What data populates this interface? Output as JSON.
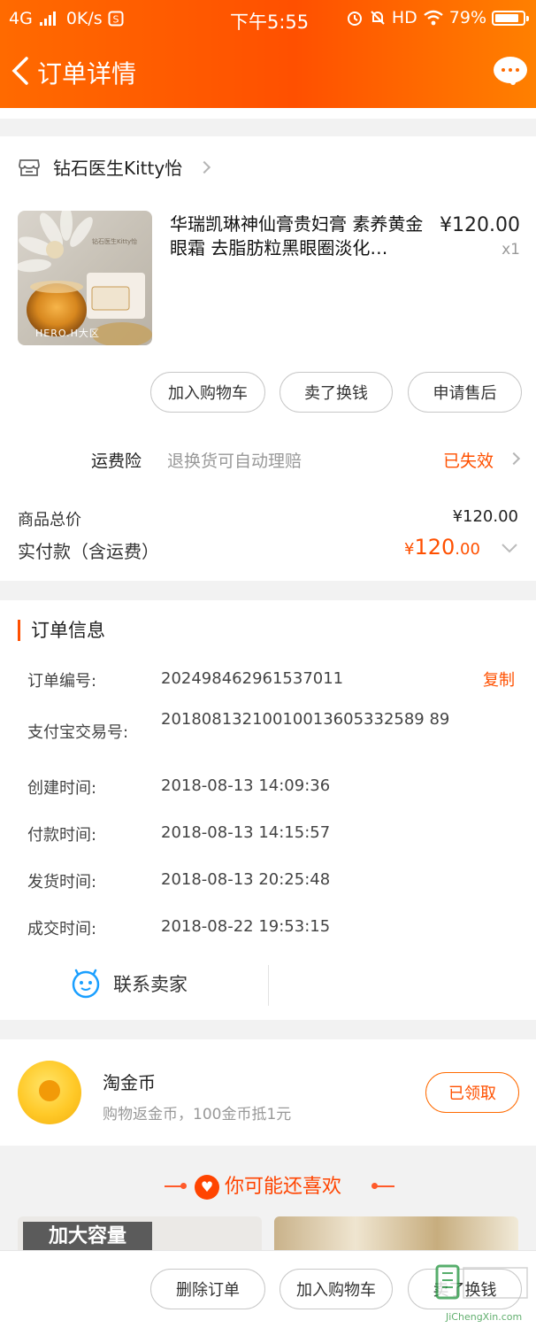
{
  "status_bar": {
    "network": "4G",
    "speed": "0K/s",
    "time": "下午5:55",
    "hd": "HD",
    "battery": "79%"
  },
  "nav": {
    "title": "订单详情"
  },
  "shop": {
    "name": "钻石医生Kitty怡"
  },
  "product": {
    "title": "华瑞凯琳神仙膏贵妇膏 素养黄金眼霜 去脂肪粒黑眼圈淡化…",
    "price": "¥120.00",
    "qty": "x1",
    "image_text_brand": "钻石医生Kitty怡",
    "image_text_stamp": "HERO.H大区"
  },
  "item_actions": {
    "add_cart": "加入购物车",
    "resell": "卖了换钱",
    "after_sale": "申请售后"
  },
  "freight_insurance": {
    "label": "运费险",
    "desc": "退换货可自动理赔",
    "status": "已失效"
  },
  "totals": {
    "goods_label": "商品总价",
    "goods_value": "¥120.00",
    "paid_label": "实付款（含运费）",
    "paid_currency": "¥",
    "paid_int": "120",
    "paid_dec": ".00"
  },
  "order_info": {
    "title": "订单信息",
    "copy": "复制",
    "rows": [
      {
        "key": "订单编号:",
        "value": "202498462961537011"
      },
      {
        "key": "支付宝交易号:",
        "value": "20180813210010013605332589 89"
      },
      {
        "key": "创建时间:",
        "value": "2018-08-13 14:09:36"
      },
      {
        "key": "付款时间:",
        "value": "2018-08-13 14:15:57"
      },
      {
        "key": "发货时间:",
        "value": "2018-08-13 20:25:48"
      },
      {
        "key": "成交时间:",
        "value": "2018-08-22 19:53:15"
      }
    ]
  },
  "contact": {
    "label": "联系卖家"
  },
  "coins": {
    "title": "淘金币",
    "desc": "购物返金币，100金币抵1元",
    "button": "已领取"
  },
  "recommend": {
    "title": "你可能还喜欢",
    "banner_text": "加大容量"
  },
  "bottom_actions": {
    "delete": "删除订单",
    "add_cart": "加入购物车",
    "resell": "卖了换钱"
  },
  "watermark": {
    "text": "JiChengXin.com"
  },
  "colors": {
    "accent": "#ff5000",
    "nav_gradient_start": "#ff6a00",
    "nav_gradient_end": "#ff8000"
  }
}
